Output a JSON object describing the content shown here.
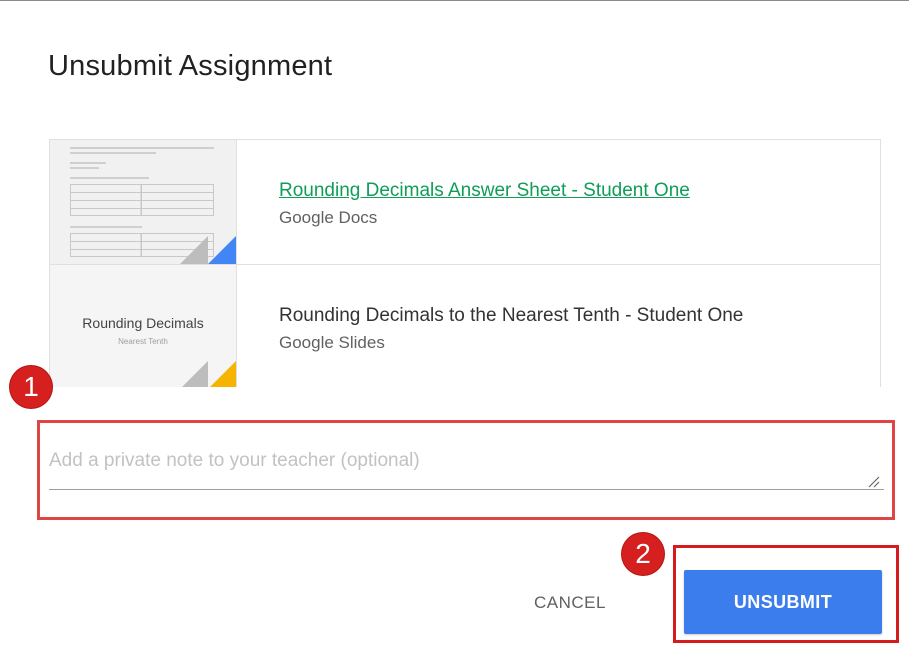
{
  "dialog": {
    "title": "Unsubmit Assignment"
  },
  "attachments": [
    {
      "title": "Rounding Decimals Answer Sheet - Student One",
      "type": "Google Docs",
      "linked": true,
      "corner_color": "#4285f4",
      "icon": "google-docs-icon"
    },
    {
      "title": "Rounding Decimals to the Nearest Tenth - Student One",
      "type": "Google Slides",
      "linked": false,
      "corner_color": "#f4b400",
      "icon": "google-slides-icon",
      "thumbnail_title": "Rounding Decimals",
      "thumbnail_subtitle": "Nearest Tenth"
    }
  ],
  "note": {
    "placeholder": "Add a private note to your teacher (optional)",
    "value": ""
  },
  "actions": {
    "cancel_label": "CANCEL",
    "unsubmit_label": "UNSUBMIT"
  },
  "annotations": {
    "step1": "1",
    "step2": "2",
    "highlight_color": "#e04545"
  },
  "colors": {
    "primary": "#3b7ded",
    "link": "#0f9d58",
    "badge": "#d61f1f"
  }
}
